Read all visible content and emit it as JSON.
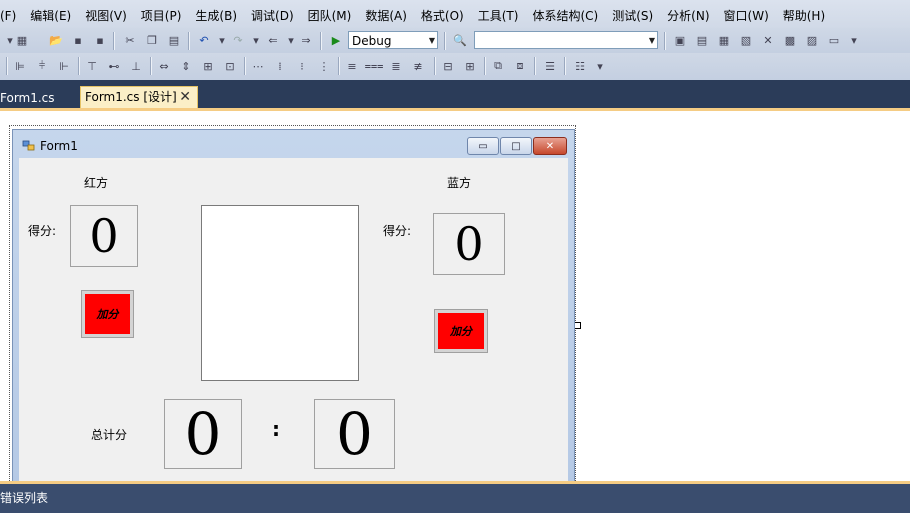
{
  "menu": [
    "(F)",
    "编辑(E)",
    "视图(V)",
    "项目(P)",
    "生成(B)",
    "调试(D)",
    "团队(M)",
    "数据(A)",
    "格式(O)",
    "工具(T)",
    "体系结构(C)",
    "测试(S)",
    "分析(N)",
    "窗口(W)",
    "帮助(H)"
  ],
  "toolbar": {
    "config_value": "Debug",
    "platform_value": ""
  },
  "tabs": {
    "inactive_label": "Form1.cs",
    "active_label": "Form1.cs [设计]",
    "close_glyph": "✕"
  },
  "form": {
    "title": "Form1",
    "caption_buttons": {
      "minimize": "▭",
      "maximize": "□",
      "close": "✕"
    },
    "red_label": "红方",
    "blue_label": "蓝方",
    "score_label_red": "得分:",
    "score_label_blue": "得分:",
    "red_score": "0",
    "blue_score": "0",
    "add_button_red": "加分",
    "add_button_blue": "加分",
    "total_label": "总计分",
    "total_red": "0",
    "total_colon": ":",
    "total_blue": "0"
  },
  "bottom_panel": {
    "title": "错误列表"
  },
  "colors": {
    "add_button": "#ff0000",
    "tab_strip": "#2b3c59",
    "accent_line": "#f5cc84",
    "form_client": "#f0f0f0"
  }
}
